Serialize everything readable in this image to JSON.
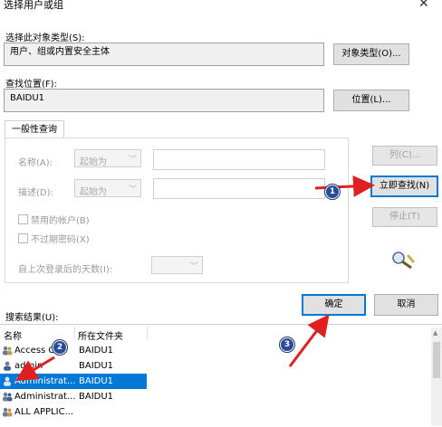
{
  "window": {
    "title": "选择用户或组",
    "close_glyph": "✕"
  },
  "object_type": {
    "label": "选择此对象类型(S):",
    "value": "用户、组或内置安全主体",
    "button": "对象类型(O)..."
  },
  "location": {
    "label": "查找位置(F):",
    "value": "BAIDU1",
    "button": "位置(L)..."
  },
  "query": {
    "tab": "一般性查询",
    "name_label": "名称(A):",
    "name_mode": "起始为",
    "desc_label": "描述(D):",
    "desc_mode": "起始为",
    "disabled_accounts": "禁用的帐户(B)",
    "no_expire_pwd": "不过期密码(X)",
    "days_since_logon": "自上次登录后的天数(I):"
  },
  "side_buttons": {
    "columns": "列(C)...",
    "find_now": "立即查找(N)",
    "stop": "停止(T)"
  },
  "ok": "确定",
  "cancel": "取消",
  "results": {
    "label": "搜索结果(U):",
    "col_name": "名称",
    "col_folder": "所在文件夹",
    "rows": [
      {
        "name": "Access C...",
        "folder": "BAIDU1",
        "icon": "group-icon"
      },
      {
        "name": "admin",
        "folder": "BAIDU1",
        "icon": "user-icon"
      },
      {
        "name": "Administrat...",
        "folder": "BAIDU1",
        "icon": "user-icon",
        "selected": true
      },
      {
        "name": "Administrat...",
        "folder": "BAIDU1",
        "icon": "group-icon"
      },
      {
        "name": "ALL APPLIC...",
        "folder": "",
        "icon": "group-icon"
      }
    ]
  },
  "markers": {
    "m1": "1",
    "m2": "2",
    "m3": "3"
  },
  "colors": {
    "accent": "#0078d7",
    "annotation_red": "#e02020",
    "marker_blue": "#2a4a9a"
  }
}
